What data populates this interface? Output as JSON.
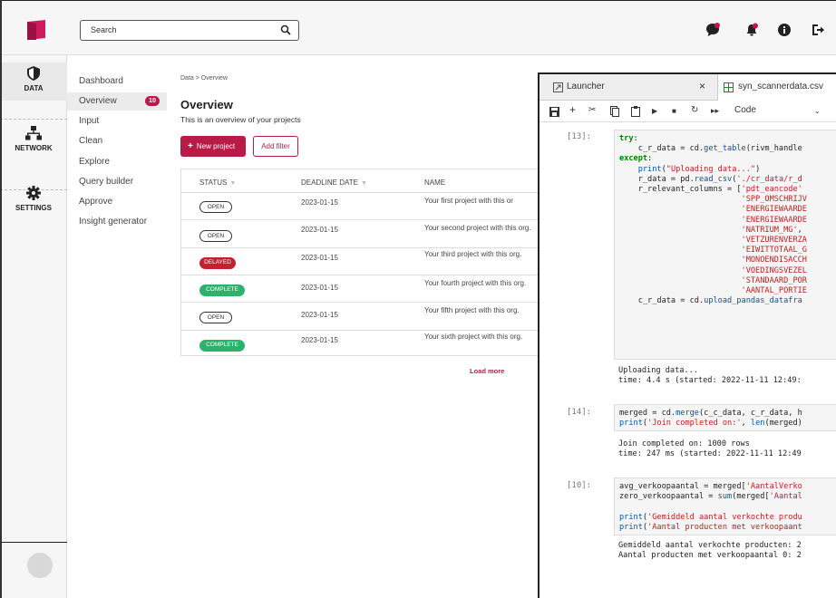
{
  "header": {
    "search_placeholder": "Search",
    "icons": [
      "chat-icon",
      "notification-bell-icon",
      "info-icon",
      "logout-icon"
    ]
  },
  "rail": {
    "items": [
      {
        "label": "DATA",
        "icon": "shield-icon",
        "active": true
      },
      {
        "label": "NETWORK",
        "icon": "network-icon",
        "active": false
      },
      {
        "label": "SETTINGS",
        "icon": "gear-icon",
        "active": false
      }
    ]
  },
  "subnav": {
    "items": [
      {
        "label": "Dashboard"
      },
      {
        "label": "Overview",
        "badge": "10",
        "active": true
      },
      {
        "label": "Input"
      },
      {
        "label": "Clean"
      },
      {
        "label": "Explore"
      },
      {
        "label": "Query builder"
      },
      {
        "label": "Approve"
      },
      {
        "label": "Insight generator"
      }
    ]
  },
  "main": {
    "breadcrumb": "Data > Overview",
    "title": "Overview",
    "subtitle": "This is an overview of your projects",
    "new_project_label": "New project",
    "add_filter_label": "Add filter",
    "load_more_label": "Load more",
    "columns": [
      "STATUS",
      "DEADLINE DATE",
      "NAME"
    ],
    "rows": [
      {
        "status": "OPEN",
        "kind": "open",
        "date": "2023-01-15",
        "name": "Your first project with this or"
      },
      {
        "status": "OPEN",
        "kind": "open",
        "date": "2023-01-15",
        "name": "Your second project with this org."
      },
      {
        "status": "DELAYED",
        "kind": "delayed",
        "date": "2023-01-15",
        "name": "Your third project with this org."
      },
      {
        "status": "COMPLETE",
        "kind": "complete",
        "date": "2023-01-15",
        "name": "Your fourth project with this org."
      },
      {
        "status": "OPEN",
        "kind": "open",
        "date": "2023-01-15",
        "name": "Your fifth project with this org."
      },
      {
        "status": "COMPLETE",
        "kind": "complete",
        "date": "2023-01-15",
        "name": "Your sixth project with this org."
      }
    ]
  },
  "jupyter": {
    "tabs": [
      "Launcher",
      "syn_scannerdata.csv"
    ],
    "cell_type": "Code",
    "cells": [
      {
        "prompt": "[13]:",
        "output": "Uploading data...\ntime: 4.4 s (started: 2022-11-11 12:49:"
      },
      {
        "prompt": "[14]:",
        "output": "Join completed on: 1000 rows\ntime: 247 ms (started: 2022-11-11 12:49"
      },
      {
        "prompt": "[10]:",
        "output": "Gemiddeld aantal verkochte producten: 2\nAantal producten met verkoopaantal 0: 2"
      }
    ]
  },
  "colors": {
    "accent": "#b81b45",
    "delayed": "#c5202f",
    "complete": "#2eb26b",
    "logo": "#d11a5c"
  }
}
